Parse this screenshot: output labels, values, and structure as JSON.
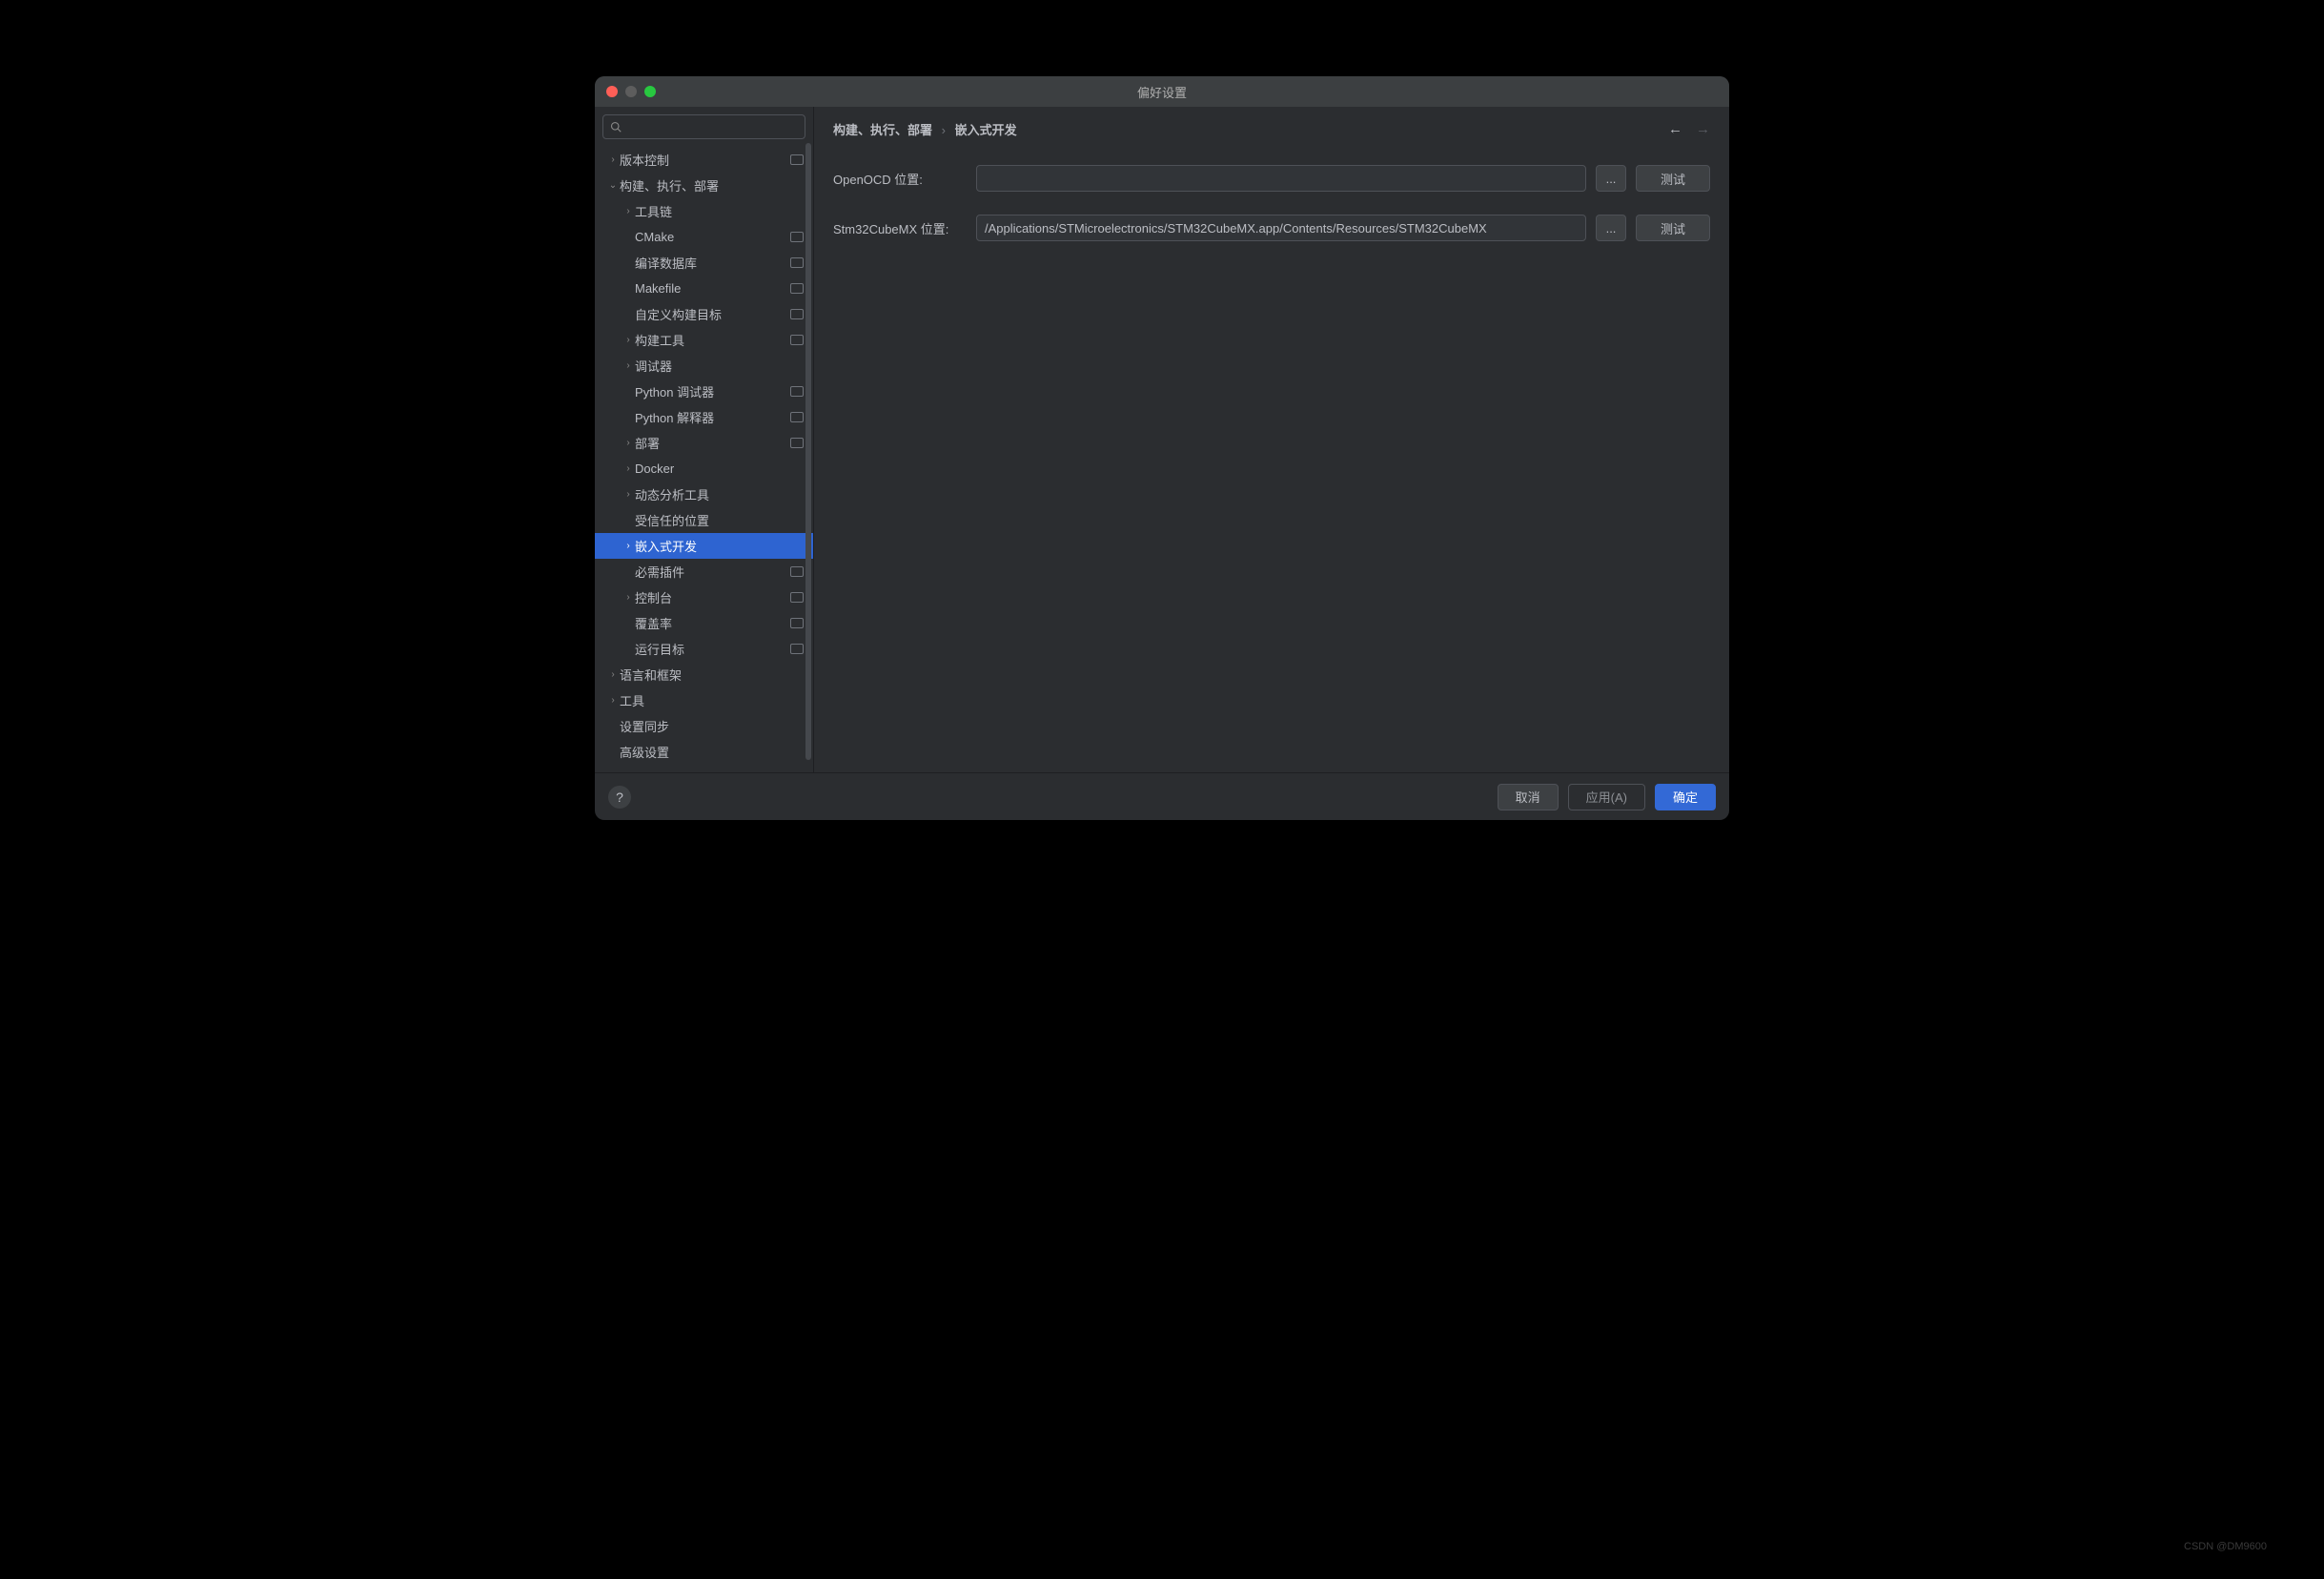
{
  "window_title": "偏好设置",
  "search_placeholder": "",
  "breadcrumb": {
    "parent": "构建、执行、部署",
    "current": "嵌入式开发"
  },
  "sidebar": {
    "items": [
      {
        "label": "版本控制",
        "level": 1,
        "expandable": true,
        "expanded": false,
        "badge": true,
        "selected": false
      },
      {
        "label": "构建、执行、部署",
        "level": 1,
        "expandable": true,
        "expanded": true,
        "badge": false,
        "selected": false
      },
      {
        "label": "工具链",
        "level": 2,
        "expandable": true,
        "expanded": false,
        "badge": false,
        "selected": false
      },
      {
        "label": "CMake",
        "level": 2,
        "expandable": false,
        "expanded": false,
        "badge": true,
        "selected": false
      },
      {
        "label": "编译数据库",
        "level": 2,
        "expandable": false,
        "expanded": false,
        "badge": true,
        "selected": false
      },
      {
        "label": "Makefile",
        "level": 2,
        "expandable": false,
        "expanded": false,
        "badge": true,
        "selected": false
      },
      {
        "label": "自定义构建目标",
        "level": 2,
        "expandable": false,
        "expanded": false,
        "badge": true,
        "selected": false
      },
      {
        "label": "构建工具",
        "level": 2,
        "expandable": true,
        "expanded": false,
        "badge": true,
        "selected": false
      },
      {
        "label": "调试器",
        "level": 2,
        "expandable": true,
        "expanded": false,
        "badge": false,
        "selected": false
      },
      {
        "label": "Python 调试器",
        "level": 2,
        "expandable": false,
        "expanded": false,
        "badge": true,
        "selected": false
      },
      {
        "label": "Python 解释器",
        "level": 2,
        "expandable": false,
        "expanded": false,
        "badge": true,
        "selected": false
      },
      {
        "label": "部署",
        "level": 2,
        "expandable": true,
        "expanded": false,
        "badge": true,
        "selected": false
      },
      {
        "label": "Docker",
        "level": 2,
        "expandable": true,
        "expanded": false,
        "badge": false,
        "selected": false
      },
      {
        "label": "动态分析工具",
        "level": 2,
        "expandable": true,
        "expanded": false,
        "badge": false,
        "selected": false
      },
      {
        "label": "受信任的位置",
        "level": 2,
        "expandable": false,
        "expanded": false,
        "badge": false,
        "selected": false
      },
      {
        "label": "嵌入式开发",
        "level": 2,
        "expandable": true,
        "expanded": false,
        "badge": false,
        "selected": true
      },
      {
        "label": "必需插件",
        "level": 2,
        "expandable": false,
        "expanded": false,
        "badge": true,
        "selected": false
      },
      {
        "label": "控制台",
        "level": 2,
        "expandable": true,
        "expanded": false,
        "badge": true,
        "selected": false
      },
      {
        "label": "覆盖率",
        "level": 2,
        "expandable": false,
        "expanded": false,
        "badge": true,
        "selected": false
      },
      {
        "label": "运行目标",
        "level": 2,
        "expandable": false,
        "expanded": false,
        "badge": true,
        "selected": false
      },
      {
        "label": "语言和框架",
        "level": 1,
        "expandable": true,
        "expanded": false,
        "badge": false,
        "selected": false
      },
      {
        "label": "工具",
        "level": 1,
        "expandable": true,
        "expanded": false,
        "badge": false,
        "selected": false
      },
      {
        "label": "设置同步",
        "level": 1,
        "expandable": false,
        "expanded": false,
        "badge": false,
        "selected": false
      },
      {
        "label": "高级设置",
        "level": 1,
        "expandable": false,
        "expanded": false,
        "badge": false,
        "selected": false
      }
    ]
  },
  "form": {
    "openocd_label": "OpenOCD 位置:",
    "openocd_value": "",
    "cubemx_label": "Stm32CubeMX 位置:",
    "cubemx_value": "/Applications/STMicroelectronics/STM32CubeMX.app/Contents/Resources/STM32CubeMX",
    "browse_label": "...",
    "test_label": "测试"
  },
  "footer": {
    "help": "?",
    "cancel": "取消",
    "apply": "应用(A)",
    "ok": "确定"
  },
  "watermark": "CSDN @DM9600"
}
